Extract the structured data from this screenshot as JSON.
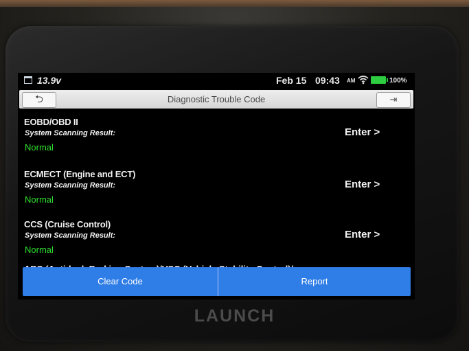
{
  "status_bar": {
    "voltage": "13.9v",
    "date": "Feb 15",
    "time": "09:43",
    "ampm": "AM",
    "battery": "100%"
  },
  "header": {
    "back_icon": "⮌",
    "title": "Diagnostic Trouble Code",
    "exit_icon": "⇥"
  },
  "systems": [
    {
      "name": "EOBD/OBD II",
      "subtitle": "System Scanning Result:",
      "status": "Normal",
      "enter": "Enter >"
    },
    {
      "name": "ECMECT (Engine and ECT)",
      "subtitle": "System Scanning Result:",
      "status": "Normal",
      "enter": "Enter >"
    },
    {
      "name": "CCS (Cruise Control)",
      "subtitle": "System Scanning Result:",
      "status": "Normal",
      "enter": "Enter >"
    }
  ],
  "partial_item": "ABS (Anti-lock Braking System)/VSC (Vehicle Stability Control)/",
  "actions": {
    "clear_code": "Clear Code",
    "report": "Report"
  },
  "brand": "LAUNCH",
  "colors": {
    "accent": "#2f7de6",
    "status_normal": "#2fe02f",
    "battery": "#2ecc40"
  }
}
